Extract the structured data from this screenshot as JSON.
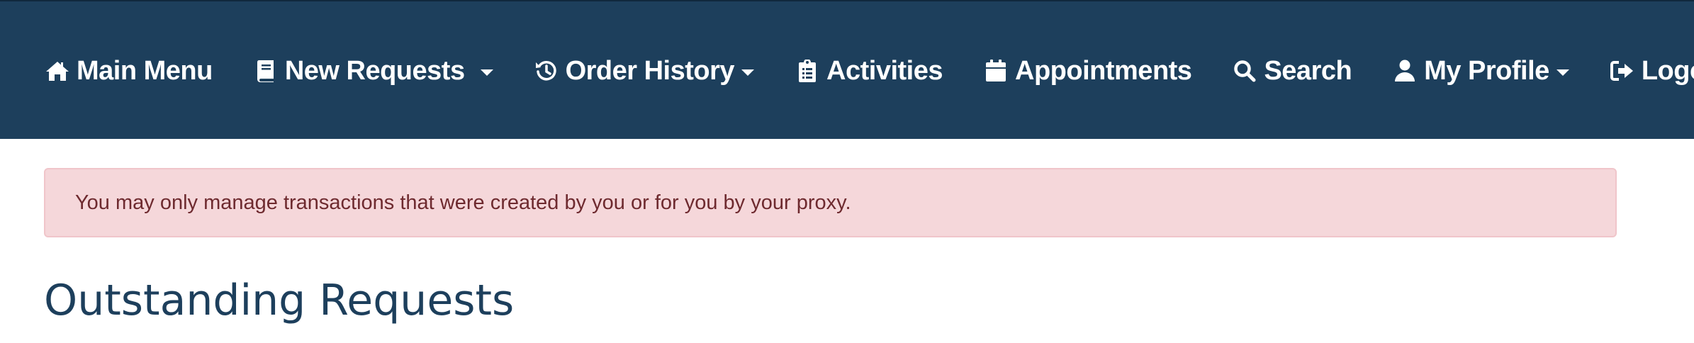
{
  "nav": {
    "items": [
      {
        "label": "Main Menu",
        "icon": "home-icon"
      },
      {
        "label": "New Requests",
        "icon": "book-icon",
        "has_dropdown": true
      },
      {
        "label": "Order History",
        "icon": "history-icon",
        "has_dropdown": true
      },
      {
        "label": "Activities",
        "icon": "clipboard-icon"
      },
      {
        "label": "Appointments",
        "icon": "calendar-icon"
      },
      {
        "label": "Search",
        "icon": "search-icon"
      },
      {
        "label": "My Profile",
        "icon": "user-icon",
        "has_dropdown": true
      },
      {
        "label": "Logoff",
        "icon": "logoff-icon"
      }
    ]
  },
  "alert": {
    "message": "You may only manage transactions that were created by you or for you by your proxy."
  },
  "main": {
    "title": "Outstanding Requests"
  },
  "colors": {
    "navbar_bg": "#1d3f5c",
    "alert_bg": "#f5d7da",
    "alert_text": "#6e2a2f",
    "title_text": "#1d3f5c"
  }
}
